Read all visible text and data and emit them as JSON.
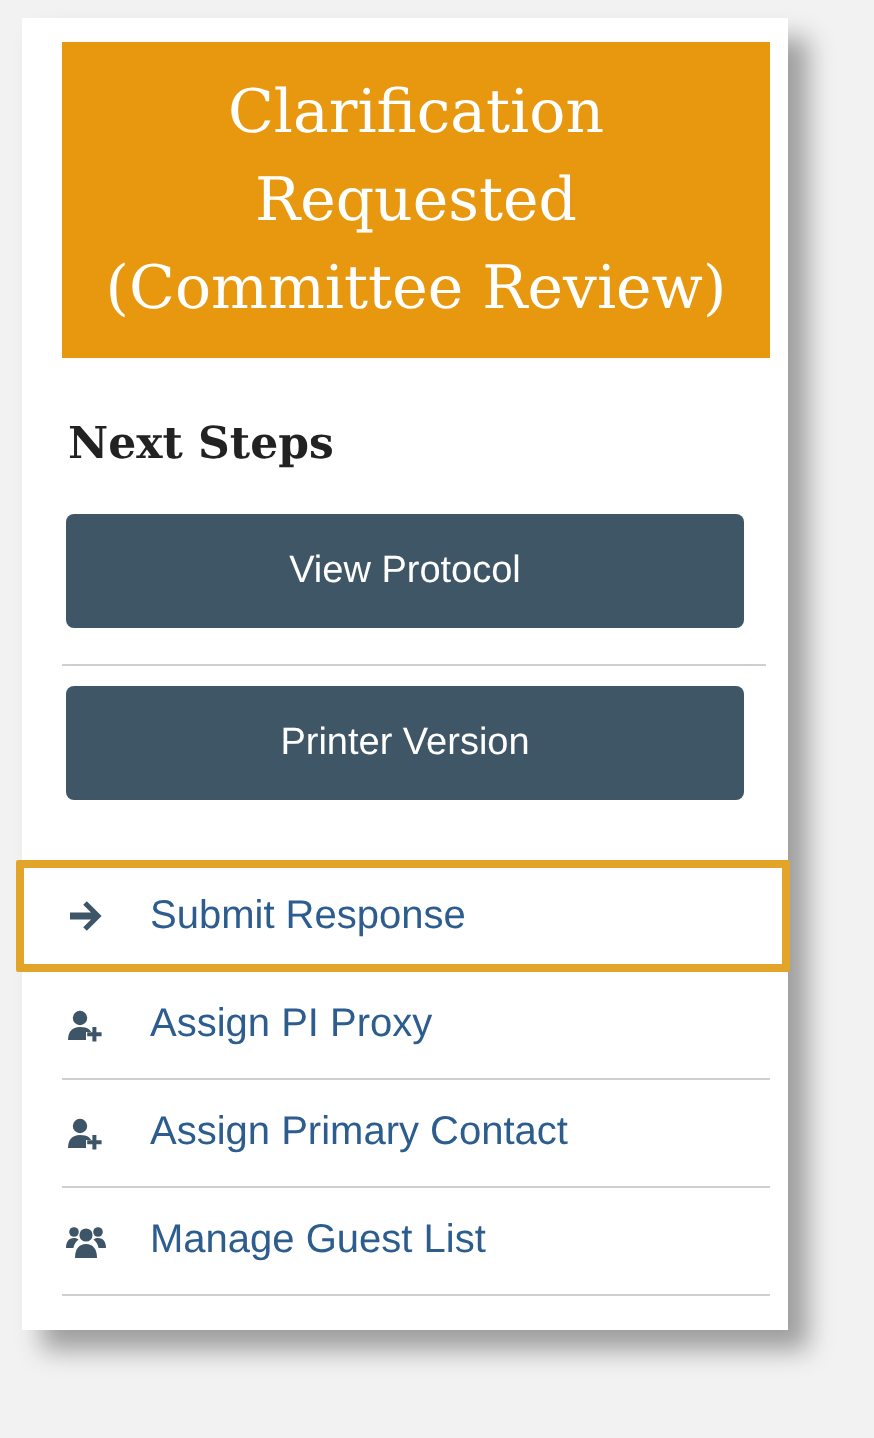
{
  "status_banner": {
    "text": "Clarification Requested (Committee Review)"
  },
  "next_steps": {
    "heading": "Next Steps",
    "buttons": [
      "View Protocol",
      "Printer Version"
    ],
    "links": [
      {
        "label": "Submit Response",
        "kind": "arrow",
        "highlighted": true
      },
      {
        "label": "Assign PI Proxy",
        "kind": "add-user",
        "highlighted": false
      },
      {
        "label": "Assign Primary Contact",
        "kind": "add-user",
        "highlighted": false
      },
      {
        "label": "Manage Guest List",
        "kind": "group",
        "highlighted": false
      }
    ]
  }
}
